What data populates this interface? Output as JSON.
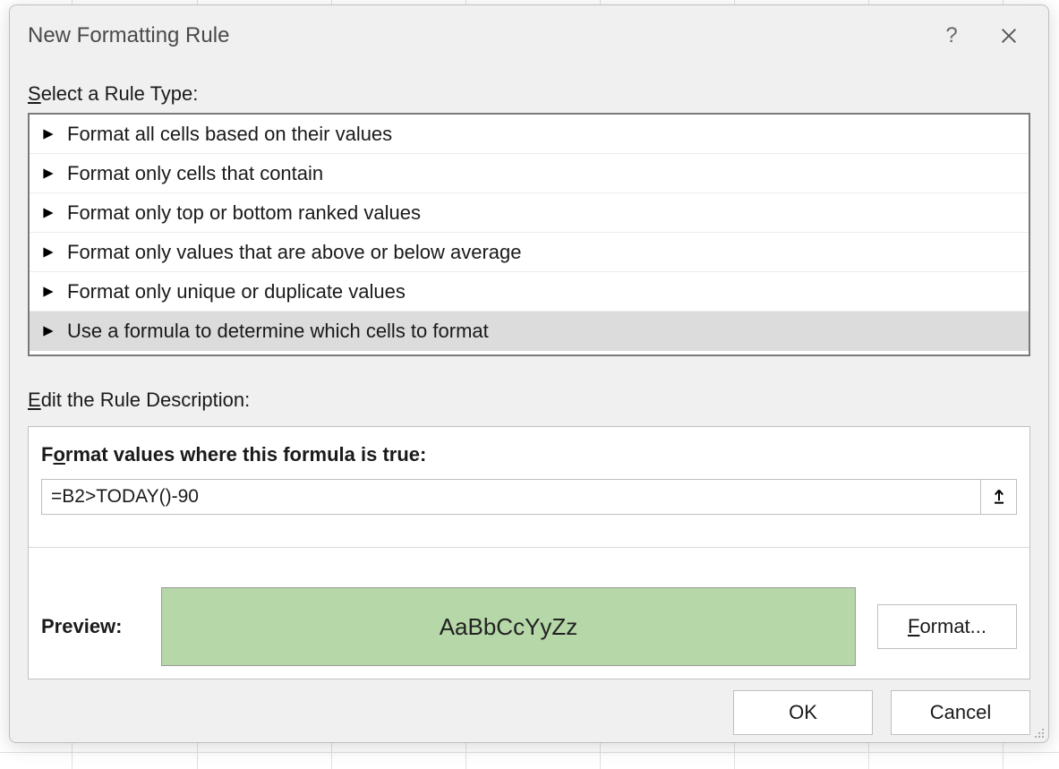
{
  "dialog": {
    "title": "New Formatting Rule",
    "help_tooltip": "?",
    "sections": {
      "select_label_prefix": "S",
      "select_label_rest": "elect a Rule Type:",
      "edit_label_prefix": "E",
      "edit_label_rest": "dit the Rule Description:"
    },
    "rule_types": [
      {
        "label": "Format all cells based on their values",
        "selected": false
      },
      {
        "label": "Format only cells that contain",
        "selected": false
      },
      {
        "label": "Format only top or bottom ranked values",
        "selected": false
      },
      {
        "label": "Format only values that are above or below average",
        "selected": false
      },
      {
        "label": "Format only unique or duplicate values",
        "selected": false
      },
      {
        "label": "Use a formula to determine which cells to format",
        "selected": true
      }
    ],
    "formula_section": {
      "label_prefix": "F",
      "label_mid": "o",
      "label_rest": "rmat values where this formula is true:",
      "formula_value": "=B2>TODAY()-90"
    },
    "preview": {
      "label": "Preview:",
      "sample_text": "AaBbCcYyZz",
      "fill_color": "#b6d7a8",
      "format_button_prefix": "F",
      "format_button_rest": "ormat..."
    },
    "buttons": {
      "ok": "OK",
      "cancel": "Cancel"
    }
  }
}
